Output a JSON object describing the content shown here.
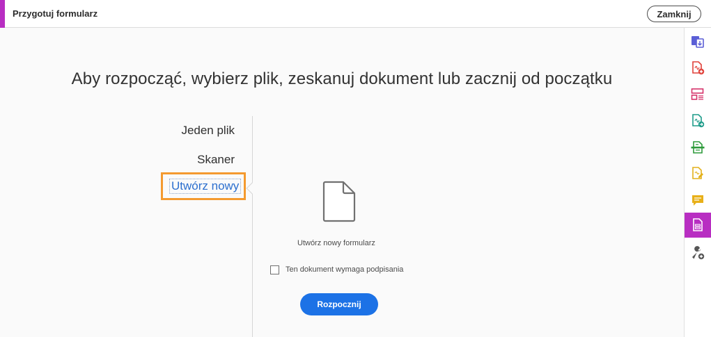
{
  "header": {
    "title": "Przygotuj formularz",
    "close_label": "Zamknij",
    "accent_color": "#b82ec2"
  },
  "main": {
    "headline": "Aby rozpocząć, wybierz plik, zeskanuj dokument lub zacznij od początku",
    "options": [
      {
        "label": "Jeden plik",
        "selected": false
      },
      {
        "label": "Skaner",
        "selected": false
      },
      {
        "label": "Utwórz nowy",
        "selected": true
      }
    ],
    "panel": {
      "icon": "document-icon",
      "caption": "Utwórz nowy formularz",
      "checkbox_label": "Ten dokument wymaga podpisania",
      "checkbox_checked": false,
      "start_label": "Rozpocznij",
      "start_color": "#1c72e6"
    }
  },
  "tool_rail": {
    "tools": [
      {
        "icon": "combine-files-icon",
        "color": "#5b5fd6"
      },
      {
        "icon": "create-pdf-icon",
        "color": "#e0413a"
      },
      {
        "icon": "organize-pages-icon",
        "color": "#d6336b"
      },
      {
        "icon": "export-pdf-icon",
        "color": "#1e9c8a"
      },
      {
        "icon": "scan-ocr-icon",
        "color": "#2e9b3b"
      },
      {
        "icon": "fill-sign-icon",
        "color": "#e3b11c"
      },
      {
        "icon": "comment-icon",
        "color": "#e8b019"
      },
      {
        "icon": "prepare-form-icon",
        "color": "#b82ec2",
        "active": true
      },
      {
        "icon": "more-tools-icon",
        "color": "#555555"
      }
    ],
    "highlight_color": "#f49a2f"
  }
}
